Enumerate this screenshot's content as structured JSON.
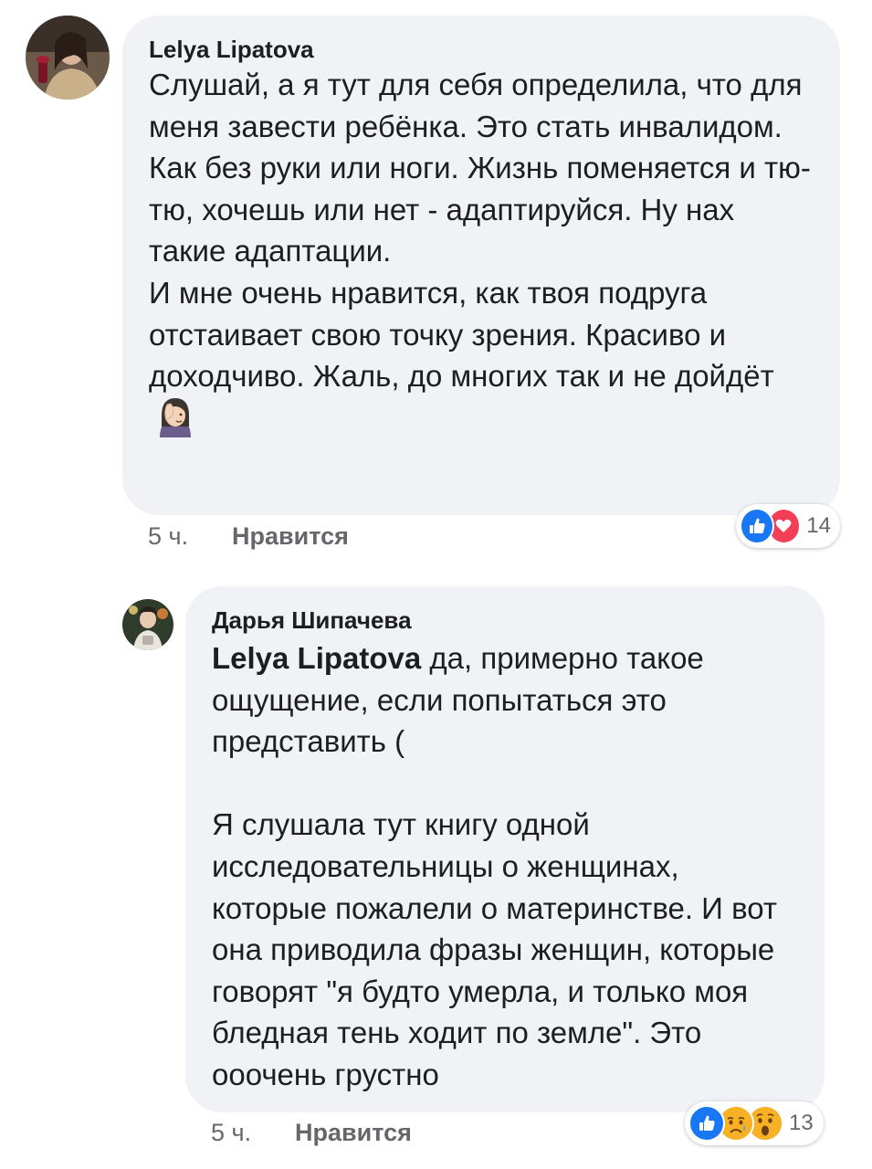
{
  "comments": [
    {
      "author": "Lelya Lipatova",
      "text": "Слушай, а я тут для себя определила, что для меня завести ребёнка. Это стать инвалидом. Как без руки или ноги. Жизнь поменяется и тю-тю, хочешь или нет - адаптируйся. Ну нах такие адаптации.\nИ мне очень нравится, как твоя подруга отстаивает свою точку зрения. Красиво и доходчиво. Жаль, до многих так и не дойдёт",
      "trailing_emoji": "face-palm-woman-emoji",
      "time": "5 ч.",
      "like_label": "Нравится",
      "reactions": [
        "like-icon",
        "love-icon"
      ],
      "reaction_count": "14"
    },
    {
      "author": "Дарья Шипачева",
      "mention": "Lelya Lipatova",
      "text": " да, примерно такое ощущение, если попытаться это представить (\n\nЯ слушала тут книгу одной исследовательницы о женщинах, которые пожалели о материнстве. И вот она приводила фразы женщин, которые говорят \"я будто умерла, и только моя бледная тень ходит по земле\". Это ооочень грустно",
      "time": "5 ч.",
      "like_label": "Нравится",
      "reactions": [
        "like-icon",
        "sad-icon",
        "wow-icon"
      ],
      "reaction_count": "13"
    }
  ],
  "colors": {
    "bubble": "#f0f2f5",
    "meta_text": "#65676b",
    "like_blue": "#1877f2",
    "love_red": "#f33e58",
    "emoji_yellow": "#f7b125"
  }
}
